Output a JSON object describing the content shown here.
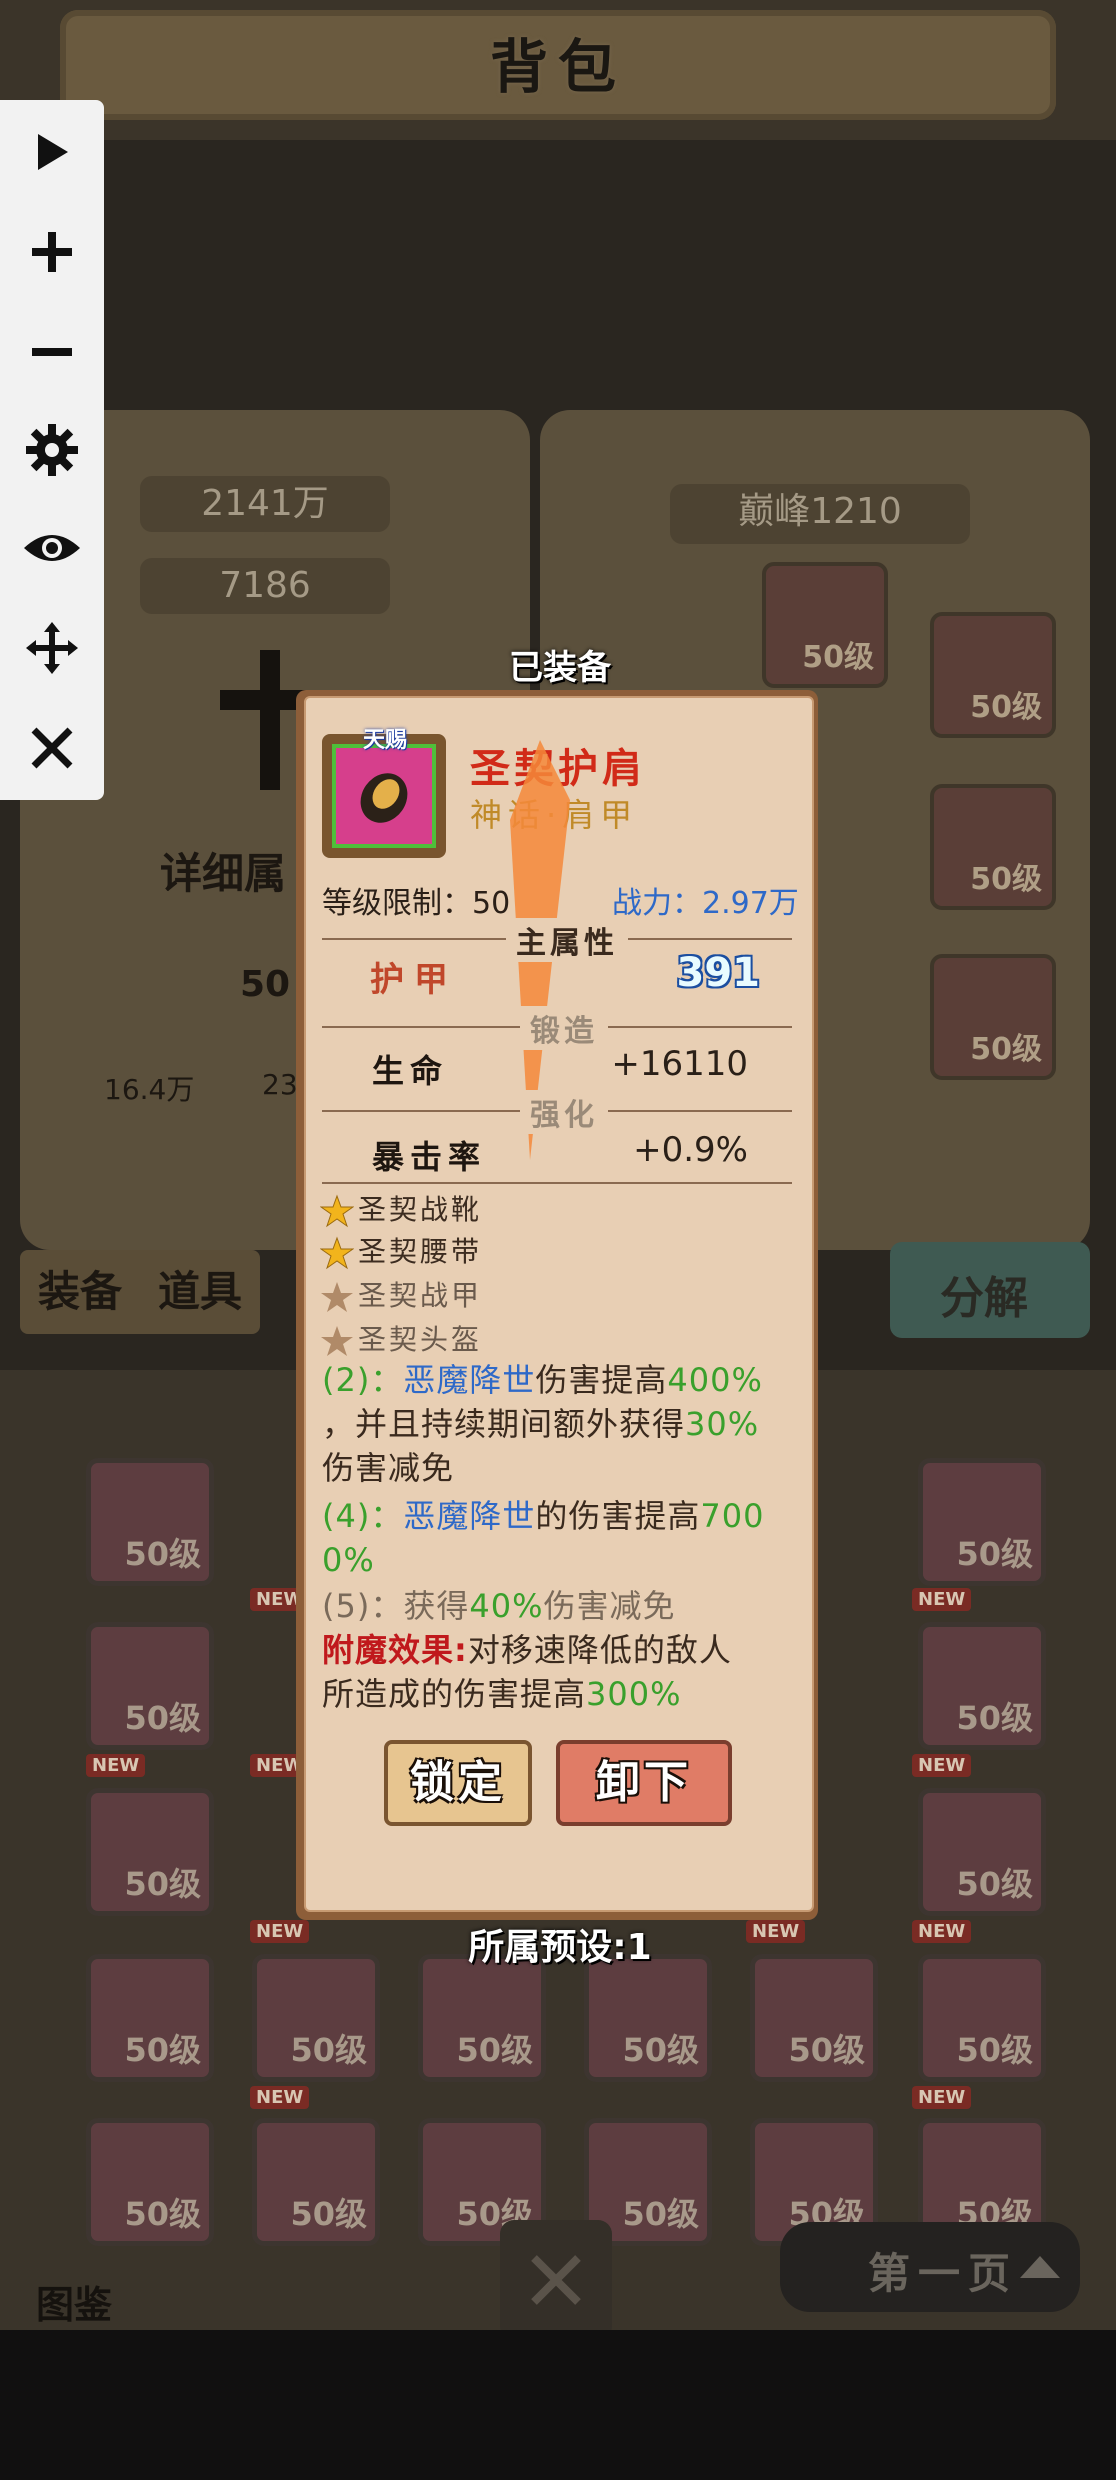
{
  "header": {
    "title": "背包"
  },
  "left_panel": {
    "gold": "2141万",
    "gems": "7186",
    "details_label": "详细属",
    "level_partial": "50",
    "attack": "16.4万",
    "hp_partial": "23"
  },
  "right_panel": {
    "peak_level": "巅峰1210"
  },
  "equip_slots_level": "50级",
  "tabs": {
    "equip": "装备",
    "items": "道具"
  },
  "decompose_button": "分解",
  "toolbar": {
    "items": [
      "play-icon",
      "zoom-in-icon",
      "zoom-out-icon",
      "settings-icon",
      "eye-icon",
      "move-icon",
      "close-icon"
    ]
  },
  "popup": {
    "equipped_label": "已装备",
    "tag": "天赐",
    "item_name": "圣契护肩",
    "item_type": "神话·肩甲",
    "level_limit": "等级限制：50",
    "power": "战力：2.97万",
    "main_attr_title": "主属性",
    "armor_label": "护甲",
    "armor_value": "391",
    "forge_title": "锻造",
    "hp_label": "生命",
    "hp_value": "+16110",
    "enhance_title": "强化",
    "crit_label": "暴击率",
    "crit_value": "+0.9%",
    "set_items": [
      {
        "name": "圣契战靴",
        "active": true
      },
      {
        "name": "圣契腰带",
        "active": true
      },
      {
        "name": "圣契战甲",
        "active": false
      },
      {
        "name": "圣契头盔",
        "active": false
      }
    ],
    "desc2_prefix": "(2)：",
    "skill_name": "恶魔降世",
    "desc2_mid": "伤害提高",
    "desc2_pct": "400%",
    "desc2_line2a": "，并且持续期间额外获得",
    "desc2_line2pct": "30%",
    "desc2_line3": "伤害减免",
    "desc4_prefix": "(4)：",
    "desc4_mid": "的伤害提高",
    "desc4_pct_a": "700",
    "desc4_pct_b": "0%",
    "desc5_prefix": "(5)：获得",
    "desc5_pct": "40%",
    "desc5_tail": "伤害减免",
    "enchant_label": "附魔效果:",
    "enchant_text1": "对移速降低的敌人",
    "enchant_text2": "所造成的伤害提高",
    "enchant_pct": "300%",
    "lock_button": "锁定",
    "unequip_button": "卸下",
    "preset": "所属预设:1"
  },
  "grid": {
    "level_label": "50级",
    "new_tag": "NEW",
    "tianci_tag": "天赐"
  },
  "bottom": {
    "page_label": "第一页",
    "codex_label": "图鉴"
  },
  "colors": {
    "accent_red": "#d12a18",
    "green": "#3aa02c",
    "blue": "#2e69c8"
  }
}
